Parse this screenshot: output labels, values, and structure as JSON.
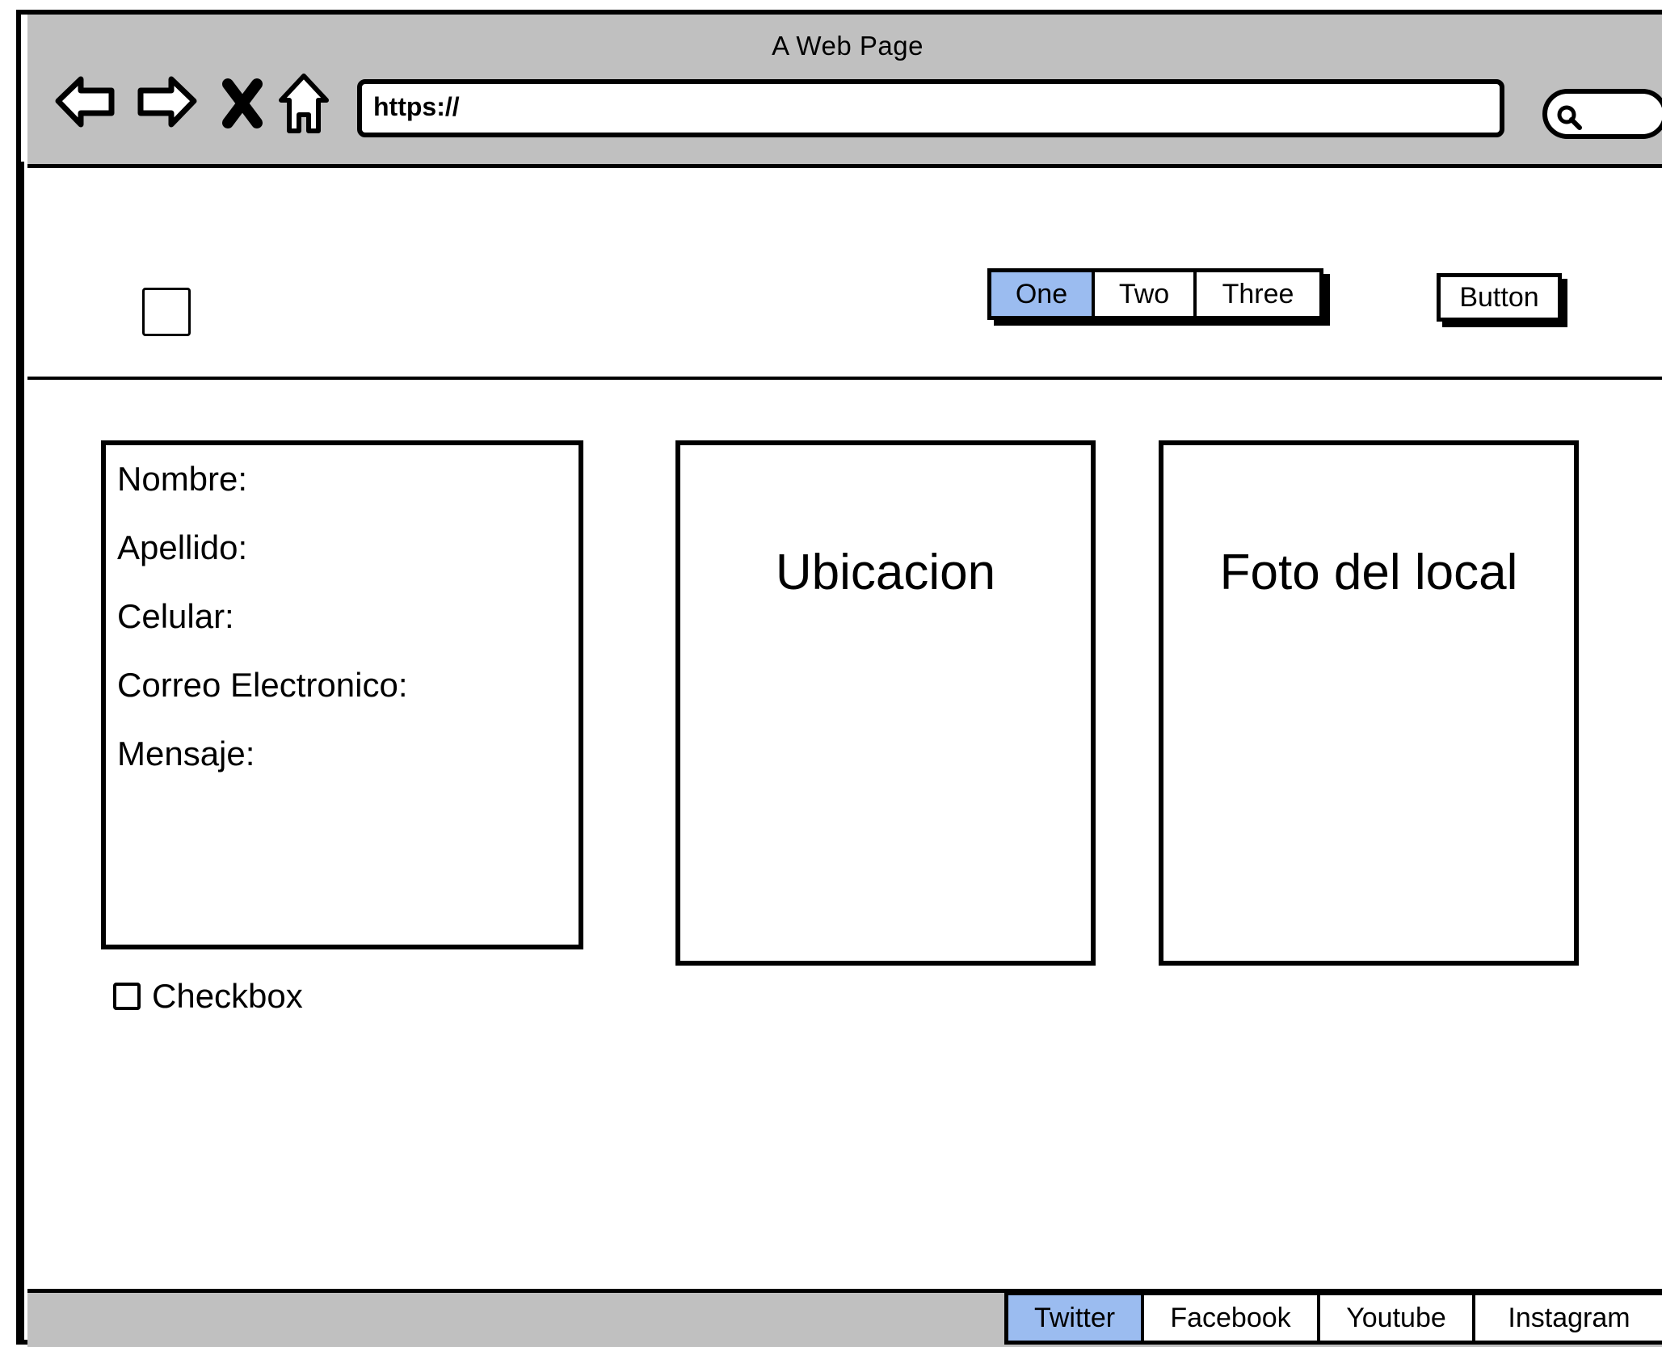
{
  "browser": {
    "title": "A Web Page",
    "url": "https://",
    "nav_icons": [
      "back-arrow-icon",
      "forward-arrow-icon",
      "close-x-icon",
      "home-icon"
    ],
    "search_icon": "search-icon"
  },
  "header": {
    "tabs": [
      {
        "label": "One",
        "active": true
      },
      {
        "label": "Two",
        "active": false
      },
      {
        "label": "Three",
        "active": false
      }
    ],
    "button_label": "Button"
  },
  "form": {
    "labels": [
      "Nombre:",
      "Apellido:",
      "Celular:",
      "Correo Electronico:",
      "Mensaje:"
    ]
  },
  "panels": {
    "map_title": "Ubicacion",
    "photo_title": "Foto del local"
  },
  "checkbox": {
    "label": "Checkbox",
    "checked": false
  },
  "footer": {
    "links": [
      {
        "label": "Twitter",
        "active": true
      },
      {
        "label": "Facebook",
        "active": false
      },
      {
        "label": "Youtube",
        "active": false
      },
      {
        "label": "Instagram",
        "active": false
      }
    ]
  },
  "colors": {
    "chrome_gray": "#c0c0c0",
    "active_blue": "#9bbcf0"
  }
}
